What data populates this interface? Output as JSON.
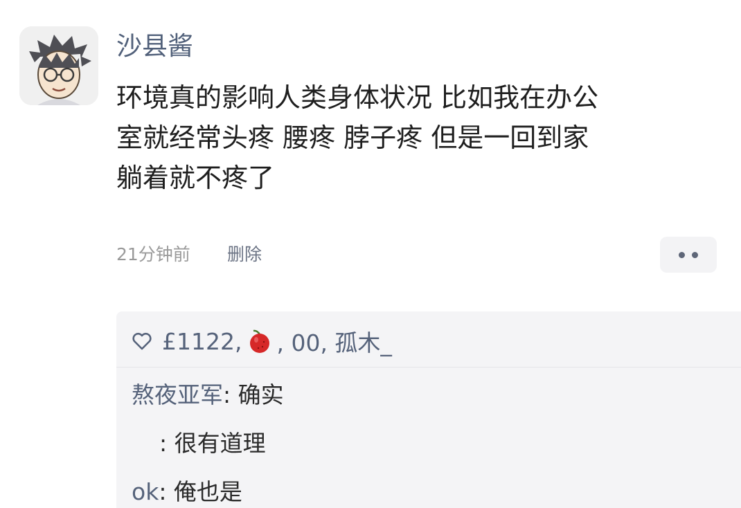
{
  "post": {
    "username": "沙县酱",
    "text_lines": [
      "环境真的影响人类身体状况 比如我在办公",
      "室就经常头疼 腰疼 脖子疼 但是一回到家",
      "躺着就不疼了"
    ],
    "time": "21分钟前",
    "delete_label": "删除"
  },
  "likes": {
    "prefix": "£1122,",
    "middle": ", 00, 孤木_"
  },
  "comments": [
    {
      "author": "熬夜亚军",
      "separator": ": ",
      "text": "确实"
    },
    {
      "author": "",
      "separator": ": ",
      "text": "很有道理"
    },
    {
      "author": "ok",
      "separator": ": ",
      "text": "俺也是"
    }
  ],
  "colors": {
    "username": "#51607a",
    "panel_background": "#f4f4f6",
    "meta_text": "#9a9a9a",
    "apple_icon": "#d62828"
  },
  "icons": {
    "avatar": "cartoon-boy-avatar",
    "like": "heart-outline-icon",
    "reaction": "red-apple-icon",
    "more": "two-dots-more-icon"
  }
}
